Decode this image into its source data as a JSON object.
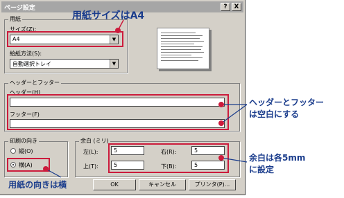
{
  "dialog": {
    "title": "ページ設定",
    "title_buttons": {
      "help": "?",
      "close": "X"
    }
  },
  "paper": {
    "group_label": "用紙",
    "size_label": "サイズ(Z):",
    "size_value": "A4",
    "source_label": "給紙方法(S):",
    "source_value": "自動選択トレイ"
  },
  "header_footer": {
    "group_label": "ヘッダーとフッター",
    "header_label": "ヘッダー(H)",
    "header_value": "",
    "footer_label": "フッター(F)",
    "footer_value": ""
  },
  "orientation": {
    "group_label": "印刷の向き",
    "portrait_label": "縦(O)",
    "landscape_label": "横(A)",
    "selected": "landscape"
  },
  "margins": {
    "group_label": "余白 (ミリ)",
    "left_label": "左(L):",
    "left_value": "5",
    "right_label": "右(R):",
    "right_value": "5",
    "top_label": "上(T):",
    "top_value": "5",
    "bottom_label": "下(B):",
    "bottom_value": "5"
  },
  "buttons": {
    "ok": "OK",
    "cancel": "キャンセル",
    "printer": "プリンタ(P)..."
  },
  "annotations": {
    "paper_size": "用紙サイズはA4",
    "header_footer_line1": "ヘッダーとフッター",
    "header_footer_line2": "は空白にする",
    "margins_line1": "余白は各5mm",
    "margins_line2": "に設定",
    "orientation": "用紙の向きは横"
  },
  "colors": {
    "highlight": "#cc1b3c",
    "callout_text": "#1a3c8c",
    "dialog_face": "#d4d0c8"
  }
}
